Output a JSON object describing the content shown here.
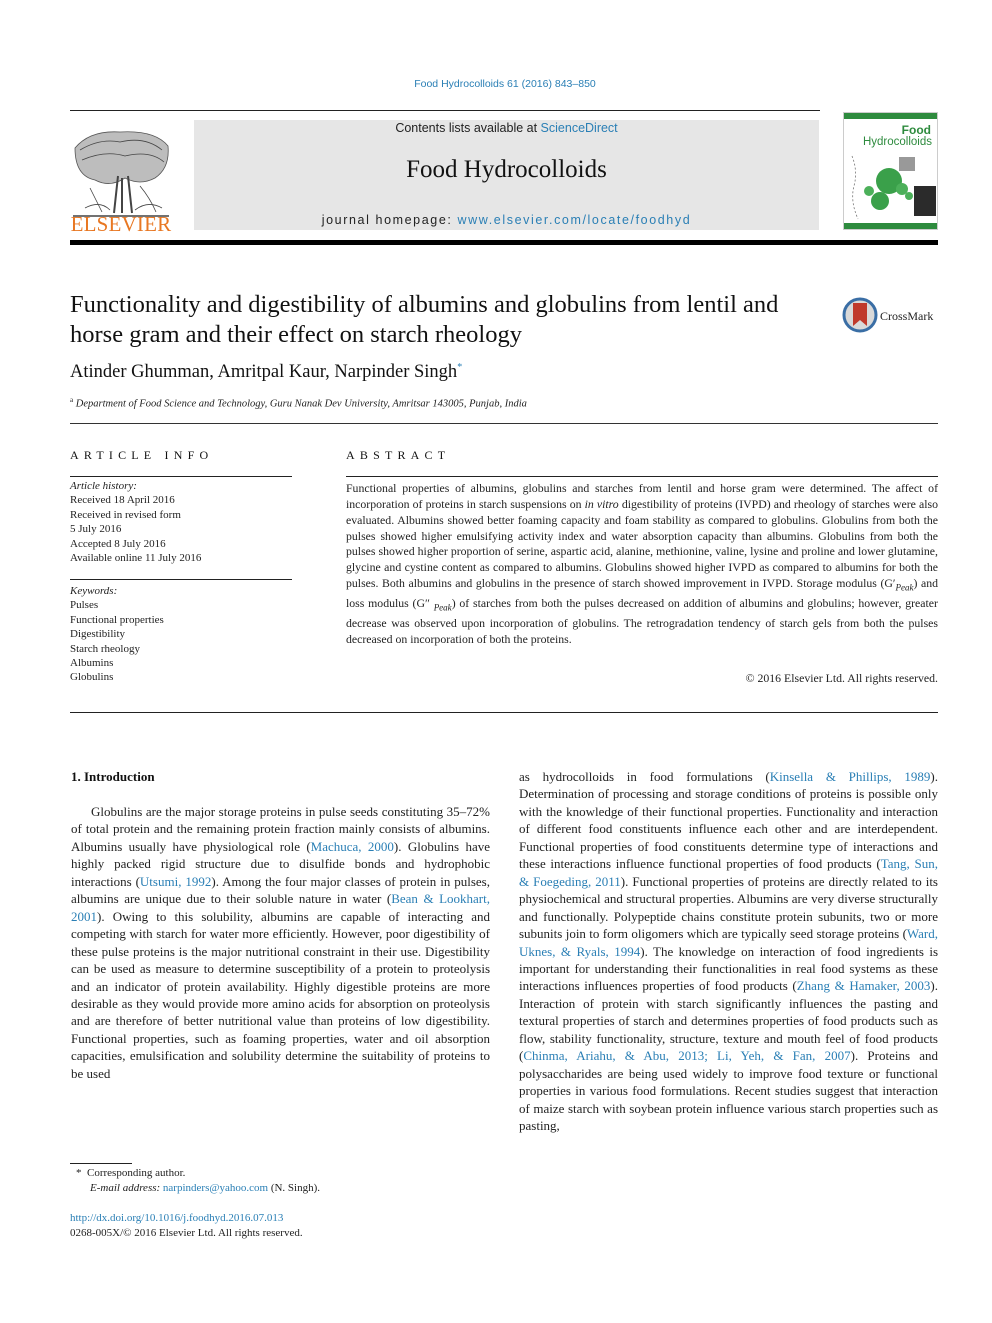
{
  "header": {
    "citation": "Food Hydrocolloids 61 (2016) 843–850",
    "publisher_logo_text": "ELSEVIER",
    "contents_prefix": "Contents lists available at ",
    "contents_link": "ScienceDirect",
    "journal_title": "Food Hydrocolloids",
    "homepage_prefix": "journal homepage: ",
    "homepage_link": "www.elsevier.com/locate/foodhyd",
    "cover_title_1": "Food",
    "cover_title_2": "Hydrocolloids",
    "crossmark_label": "CrossMark"
  },
  "article": {
    "title": "Functionality and digestibility of albumins and globulins from lentil and horse gram and their effect on starch rheology",
    "authors": "Atinder Ghumman, Amritpal Kaur, Narpinder Singh",
    "author_mark": "*",
    "affiliation_mark": "a",
    "affiliation": "Department of Food Science and Technology, Guru Nanak Dev University, Amritsar 143005, Punjab, India"
  },
  "article_info": {
    "heading": "ARTICLE INFO",
    "history_label": "Article history:",
    "history": [
      "Received 18 April 2016",
      "Received in revised form",
      "5 July 2016",
      "Accepted 8 July 2016",
      "Available online 11 July 2016"
    ],
    "keywords_label": "Keywords:",
    "keywords": [
      "Pulses",
      "Functional properties",
      "Digestibility",
      "Starch rheology",
      "Albumins",
      "Globulins"
    ]
  },
  "abstract": {
    "heading": "ABSTRACT",
    "part1": "Functional properties of albumins, globulins and starches from lentil and horse gram were determined. The affect of incorporation of proteins in starch suspensions on ",
    "italic1": "in vitro",
    "part2": " digestibility of proteins (IVPD) and rheology of starches were also evaluated. Albumins showed better foaming capacity and foam stability as compared to globulins. Globulins from both the pulses showed higher emulsifying activity index and water absorption capacity than albumins. Globulins from both the pulses showed higher proportion of serine, aspartic acid, alanine, methionine, valine, lysine and proline and lower glutamine, glycine and cystine content as compared to albumins. Globulins showed higher IVPD as compared to albumins for both the pulses. Both albumins and globulins in the presence of starch showed improvement in IVPD. Storage modulus (G′",
    "sub1": "Peak",
    "part3": ") and loss modulus (G″ ",
    "sub2": "Peak",
    "part4": ") of starches from both the pulses decreased on addition of albumins and globulins; however, greater decrease was observed upon incorporation of globulins. The retrogradation tendency of starch gels from both the pulses decreased on incorporation of both the proteins.",
    "copyright": "© 2016 Elsevier Ltd. All rights reserved."
  },
  "body": {
    "section_heading": "1.  Introduction",
    "left": {
      "t1": "Globulins are the major storage proteins in pulse seeds constituting 35–72% of total protein and the remaining protein fraction mainly consists of albumins. Albumins usually have physiological role (",
      "r1": "Machuca, 2000",
      "t2": "). Globulins have highly packed rigid structure due to disulfide bonds and hydrophobic interactions (",
      "r2": "Utsumi, 1992",
      "t3": "). Among the four major classes of protein in pulses, albumins are unique due to their soluble nature in water (",
      "r3": "Bean & Lookhart, 2001",
      "t4": "). Owing to this solubility, albumins are capable of interacting and competing with starch for water more efficiently. However, poor digestibility of these pulse proteins is the major nutritional constraint in their use. Digestibility can be used as measure to determine susceptibility of a protein to proteolysis and an indicator of protein availability. Highly digestible proteins are more desirable as they would provide more amino acids for absorption on proteolysis and are therefore of better nutritional value than proteins of low digestibility. Functional properties, such as foaming properties, water and oil absorption capacities, emulsification and solubility determine the suitability of proteins to be used"
    },
    "right": {
      "t1": "as hydrocolloids in food formulations (",
      "r1": "Kinsella & Phillips, 1989",
      "t2": "). Determination of processing and storage conditions of proteins is possible only with the knowledge of their functional properties. Functionality and interaction of different food constituents influence each other and are interdependent. Functional properties of food constituents determine type of interactions and these interactions influence functional properties of food products (",
      "r2": "Tang, Sun, & Foegeding, 2011",
      "t3": "). Functional properties of proteins are directly related to its physiochemical and structural properties. Albumins are very diverse structurally and functionally. Polypeptide chains constitute protein subunits, two or more subunits join to form oligomers which are typically seed storage proteins (",
      "r3": "Ward, Uknes, & Ryals, 1994",
      "t4": "). The knowledge on interaction of food ingredients is important for understanding their functionalities in real food systems as these interactions influences properties of food products (",
      "r4": "Zhang & Hamaker, 2003",
      "t5": "). Interaction of protein with starch significantly influences the pasting and textural properties of starch and determines properties of food products such as flow, stability functionality, structure, texture and mouth feel of food products (",
      "r5": "Chinma, Ariahu, & Abu, 2013; Li, Yeh, & Fan, 2007",
      "t6": "). Proteins and polysaccharides are being used widely to improve food texture or functional properties in various food formulations. Recent studies suggest that interaction of maize starch with soybean protein influence various starch properties such as pasting,"
    }
  },
  "footer": {
    "fn_mark": "*",
    "corresponding": "Corresponding author.",
    "email_label": "E-mail address:",
    "email": "narpinders@yahoo.com",
    "email_suffix": " (N. Singh).",
    "doi": "http://dx.doi.org/10.1016/j.foodhyd.2016.07.013",
    "issn": "0268-005X/© 2016 Elsevier Ltd. All rights reserved."
  },
  "colors": {
    "link": "#2a7fb5",
    "elsevier_orange": "#e87722",
    "masthead_bg": "#e6e6e6",
    "cover_green": "#2e8b3e",
    "crossmark_red": "#c0392b"
  }
}
